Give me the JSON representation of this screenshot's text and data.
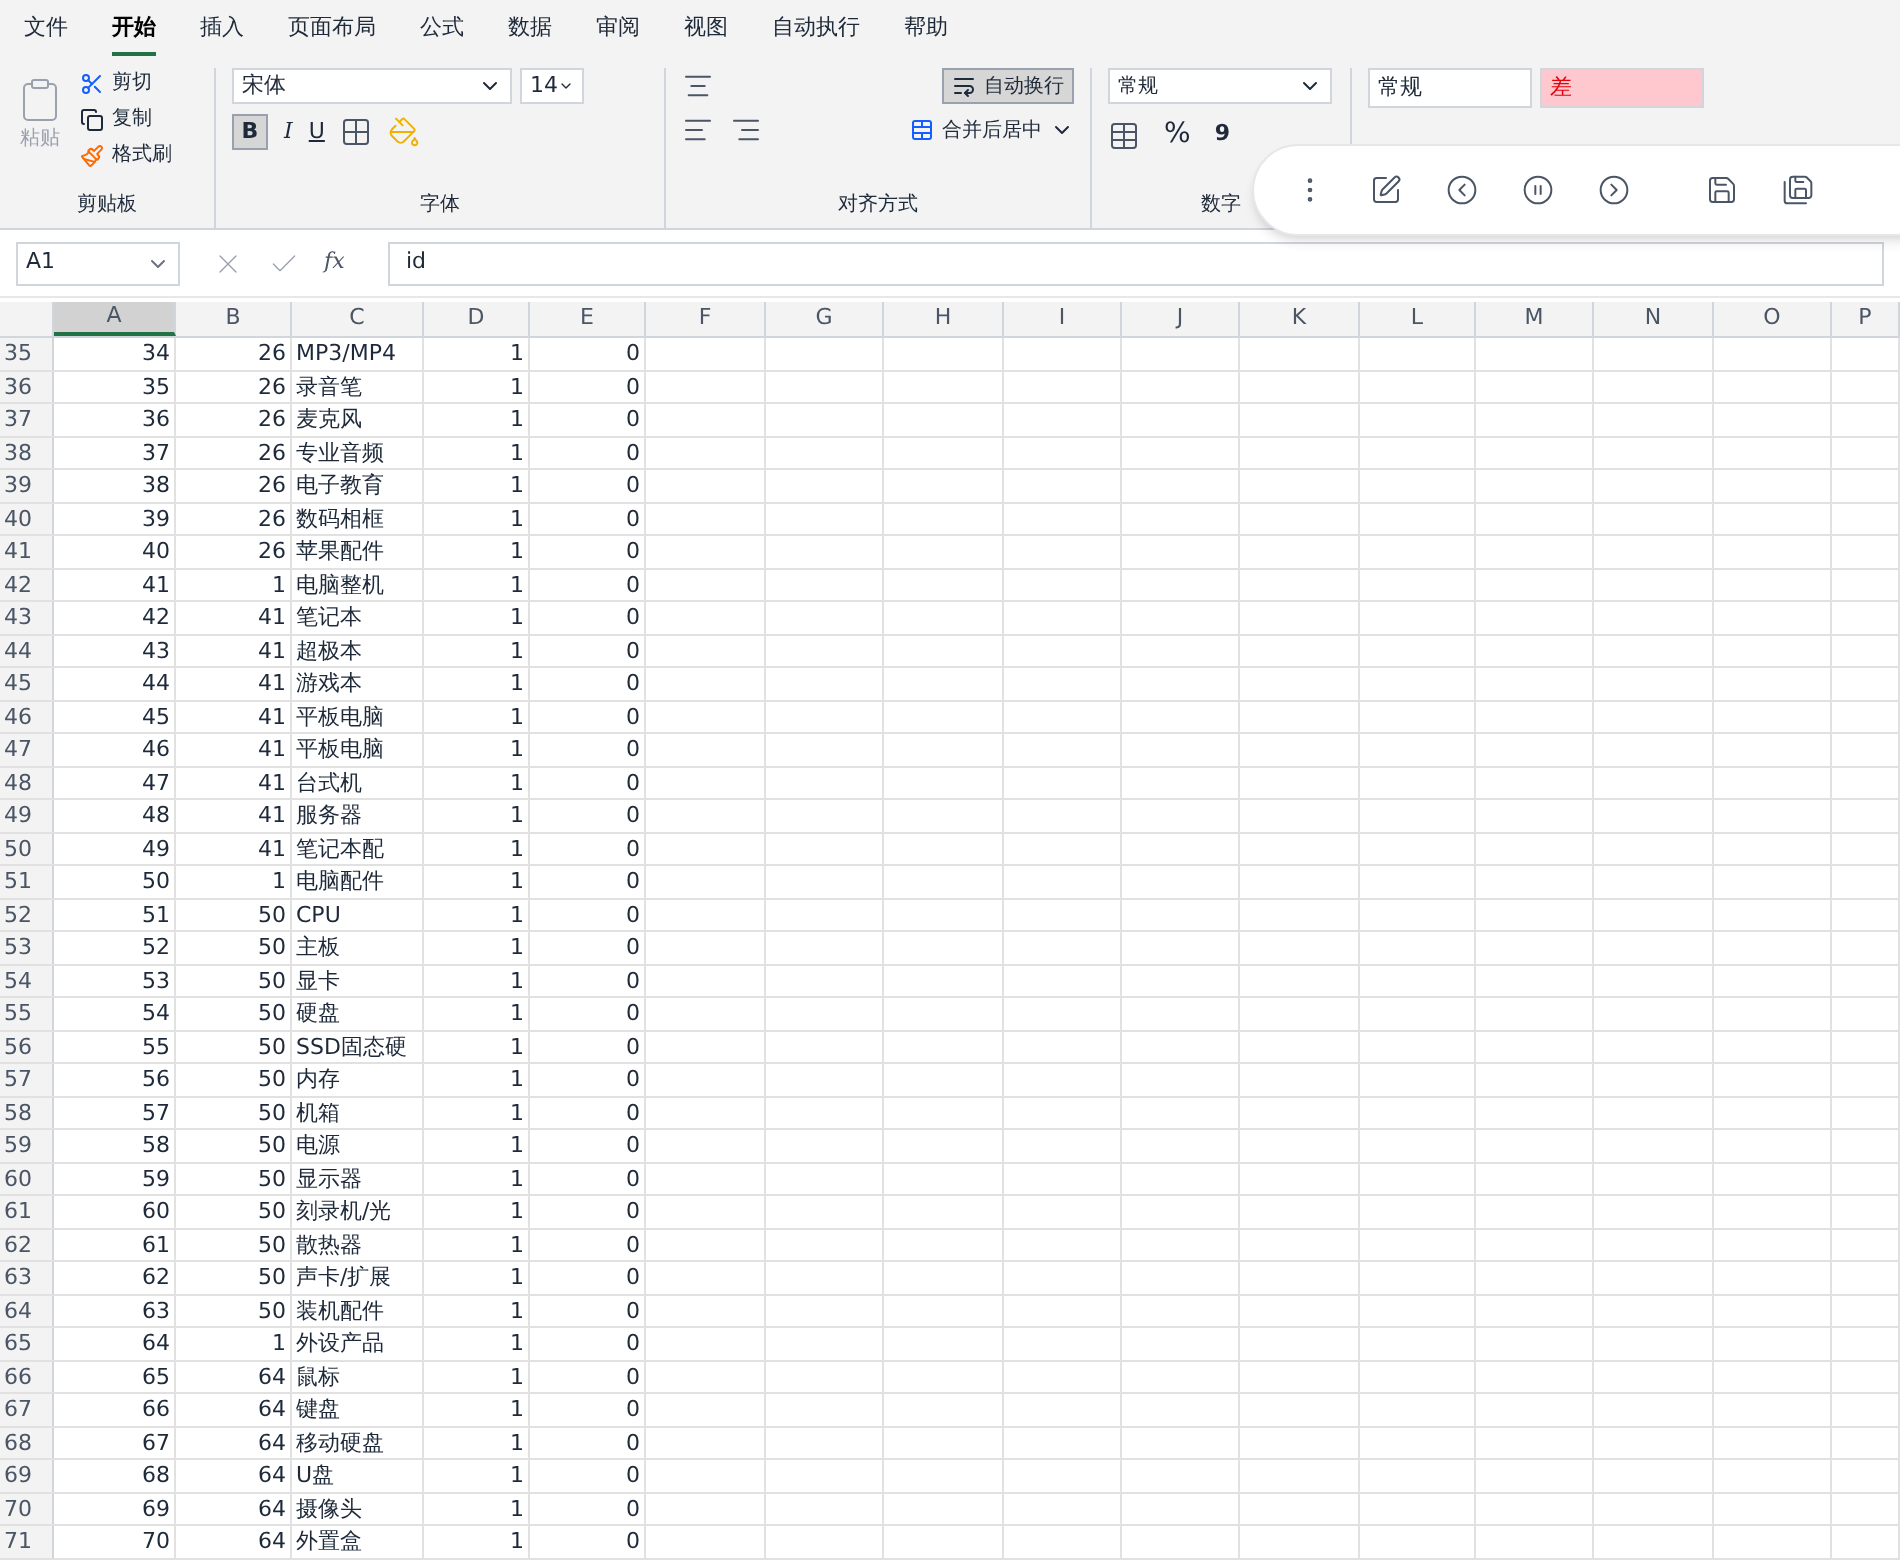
{
  "menu_tabs": [
    {
      "label": "文件",
      "selected": false
    },
    {
      "label": "开始",
      "selected": true
    },
    {
      "label": "插入",
      "selected": false
    },
    {
      "label": "页面布局",
      "selected": false
    },
    {
      "label": "公式",
      "selected": false
    },
    {
      "label": "数据",
      "selected": false
    },
    {
      "label": "审阅",
      "selected": false
    },
    {
      "label": "视图",
      "selected": false
    },
    {
      "label": "自动执行",
      "selected": false
    },
    {
      "label": "帮助",
      "selected": false
    }
  ],
  "ribbon": {
    "clipboard": {
      "paste": "粘贴",
      "cut": "剪切",
      "copy": "复制",
      "format_painter": "格式刷",
      "group": "剪贴板"
    },
    "font": {
      "name": "宋体",
      "size": "14",
      "bold": "B",
      "italic": "I",
      "underline": "U",
      "bold_on": true,
      "group": "字体"
    },
    "alignment": {
      "wrap": "自动换行",
      "wrap_on": true,
      "merge": "合并后居中",
      "group": "对齐方式"
    },
    "number": {
      "format": "常规",
      "percent": "%",
      "comma": "9",
      "group": "数字"
    },
    "styles": [
      {
        "label": "常规",
        "color": "#ffffff"
      },
      {
        "label": "差",
        "color": "#ffc7ce"
      }
    ]
  },
  "formula_bar": {
    "cell": "A1",
    "fx": "fx",
    "value": "id"
  },
  "sheet": {
    "columns": [
      {
        "label": "A",
        "selected": true
      },
      {
        "label": "B",
        "selected": false
      },
      {
        "label": "C",
        "selected": false
      },
      {
        "label": "D",
        "selected": false
      },
      {
        "label": "E",
        "selected": false
      },
      {
        "label": "F",
        "selected": false
      },
      {
        "label": "G",
        "selected": false
      },
      {
        "label": "H",
        "selected": false
      },
      {
        "label": "I",
        "selected": false
      },
      {
        "label": "J",
        "selected": false
      },
      {
        "label": "K",
        "selected": false
      },
      {
        "label": "L",
        "selected": false
      },
      {
        "label": "M",
        "selected": false
      },
      {
        "label": "N",
        "selected": false
      },
      {
        "label": "O",
        "selected": false
      },
      {
        "label": "P",
        "selected": false
      }
    ],
    "rows": [
      {
        "number": "35",
        "cells": [
          "34",
          "26",
          "MP3/MP4",
          "1",
          "0"
        ]
      },
      {
        "number": "36",
        "cells": [
          "35",
          "26",
          "录音笔",
          "1",
          "0"
        ]
      },
      {
        "number": "37",
        "cells": [
          "36",
          "26",
          "麦克风",
          "1",
          "0"
        ]
      },
      {
        "number": "38",
        "cells": [
          "37",
          "26",
          "专业音频",
          "1",
          "0"
        ]
      },
      {
        "number": "39",
        "cells": [
          "38",
          "26",
          "电子教育",
          "1",
          "0"
        ]
      },
      {
        "number": "40",
        "cells": [
          "39",
          "26",
          "数码相框",
          "1",
          "0"
        ]
      },
      {
        "number": "41",
        "cells": [
          "40",
          "26",
          "苹果配件",
          "1",
          "0"
        ]
      },
      {
        "number": "42",
        "cells": [
          "41",
          "1",
          "电脑整机",
          "1",
          "0"
        ]
      },
      {
        "number": "43",
        "cells": [
          "42",
          "41",
          "笔记本",
          "1",
          "0"
        ]
      },
      {
        "number": "44",
        "cells": [
          "43",
          "41",
          "超极本",
          "1",
          "0"
        ]
      },
      {
        "number": "45",
        "cells": [
          "44",
          "41",
          "游戏本",
          "1",
          "0"
        ]
      },
      {
        "number": "46",
        "cells": [
          "45",
          "41",
          "平板电脑",
          "1",
          "0"
        ]
      },
      {
        "number": "47",
        "cells": [
          "46",
          "41",
          "平板电脑",
          "1",
          "0"
        ]
      },
      {
        "number": "48",
        "cells": [
          "47",
          "41",
          "台式机",
          "1",
          "0"
        ]
      },
      {
        "number": "49",
        "cells": [
          "48",
          "41",
          "服务器",
          "1",
          "0"
        ]
      },
      {
        "number": "50",
        "cells": [
          "49",
          "41",
          "笔记本配",
          "1",
          "0"
        ]
      },
      {
        "number": "51",
        "cells": [
          "50",
          "1",
          "电脑配件",
          "1",
          "0"
        ]
      },
      {
        "number": "52",
        "cells": [
          "51",
          "50",
          "CPU",
          "1",
          "0"
        ]
      },
      {
        "number": "53",
        "cells": [
          "52",
          "50",
          "主板",
          "1",
          "0"
        ]
      },
      {
        "number": "54",
        "cells": [
          "53",
          "50",
          "显卡",
          "1",
          "0"
        ]
      },
      {
        "number": "55",
        "cells": [
          "54",
          "50",
          "硬盘",
          "1",
          "0"
        ]
      },
      {
        "number": "56",
        "cells": [
          "55",
          "50",
          "SSD固态硬",
          "1",
          "0"
        ]
      },
      {
        "number": "57",
        "cells": [
          "56",
          "50",
          "内存",
          "1",
          "0"
        ]
      },
      {
        "number": "58",
        "cells": [
          "57",
          "50",
          "机箱",
          "1",
          "0"
        ]
      },
      {
        "number": "59",
        "cells": [
          "58",
          "50",
          "电源",
          "1",
          "0"
        ]
      },
      {
        "number": "60",
        "cells": [
          "59",
          "50",
          "显示器",
          "1",
          "0"
        ]
      },
      {
        "number": "61",
        "cells": [
          "60",
          "50",
          "刻录机/光",
          "1",
          "0"
        ]
      },
      {
        "number": "62",
        "cells": [
          "61",
          "50",
          "散热器",
          "1",
          "0"
        ]
      },
      {
        "number": "63",
        "cells": [
          "62",
          "50",
          "声卡/扩展",
          "1",
          "0"
        ]
      },
      {
        "number": "64",
        "cells": [
          "63",
          "50",
          "装机配件",
          "1",
          "0"
        ]
      },
      {
        "number": "65",
        "cells": [
          "64",
          "1",
          "外设产品",
          "1",
          "0"
        ]
      },
      {
        "number": "66",
        "cells": [
          "65",
          "64",
          "鼠标",
          "1",
          "0"
        ]
      },
      {
        "number": "67",
        "cells": [
          "66",
          "64",
          "键盘",
          "1",
          "0"
        ]
      },
      {
        "number": "68",
        "cells": [
          "67",
          "64",
          "移动硬盘",
          "1",
          "0"
        ]
      },
      {
        "number": "69",
        "cells": [
          "68",
          "64",
          "U盘",
          "1",
          "0"
        ]
      },
      {
        "number": "70",
        "cells": [
          "69",
          "64",
          "摄像头",
          "1",
          "0"
        ]
      },
      {
        "number": "71",
        "cells": [
          "70",
          "64",
          "外置盒",
          "1",
          "0"
        ]
      }
    ]
  }
}
